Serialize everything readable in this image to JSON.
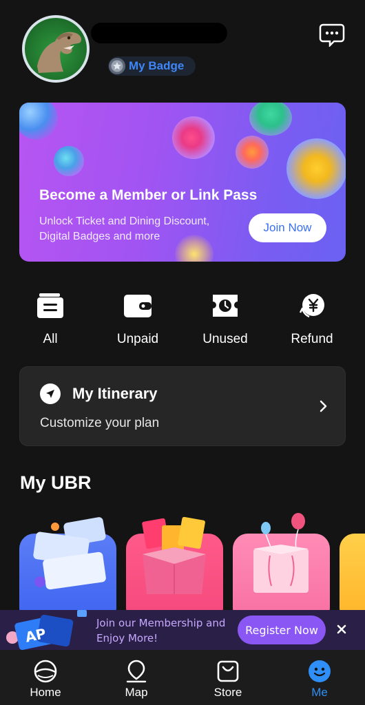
{
  "header": {
    "badge_label": "My Badge"
  },
  "banner": {
    "title": "Become a Member or Link Pass",
    "subtitle": "Unlock Ticket and Dining Discount, Digital Badges and more",
    "cta": "Join Now"
  },
  "orders": [
    {
      "label": "All",
      "icon": "all-orders-icon"
    },
    {
      "label": "Unpaid",
      "icon": "wallet-icon"
    },
    {
      "label": "Unused",
      "icon": "ticket-clock-icon"
    },
    {
      "label": "Refund",
      "icon": "yen-refund-icon"
    }
  ],
  "itinerary": {
    "title": "My Itinerary",
    "subtitle": "Customize your plan"
  },
  "section": {
    "title": "My UBR"
  },
  "promo": {
    "line1": "Join our Membership and",
    "line2": "Enjoy More!",
    "cta": "Register Now"
  },
  "tabs": [
    {
      "label": "Home",
      "icon": "home-globe-icon",
      "active": false
    },
    {
      "label": "Map",
      "icon": "map-pin-icon",
      "active": false
    },
    {
      "label": "Store",
      "icon": "shopping-bag-icon",
      "active": false
    },
    {
      "label": "Me",
      "icon": "smiley-face-icon",
      "active": true
    }
  ],
  "colors": {
    "background": "#141414",
    "accent_blue": "#2f8ff7",
    "banner_gradient_start": "#b755f2",
    "banner_gradient_end": "#6a62f2",
    "promo_button": "#8a57f5"
  }
}
